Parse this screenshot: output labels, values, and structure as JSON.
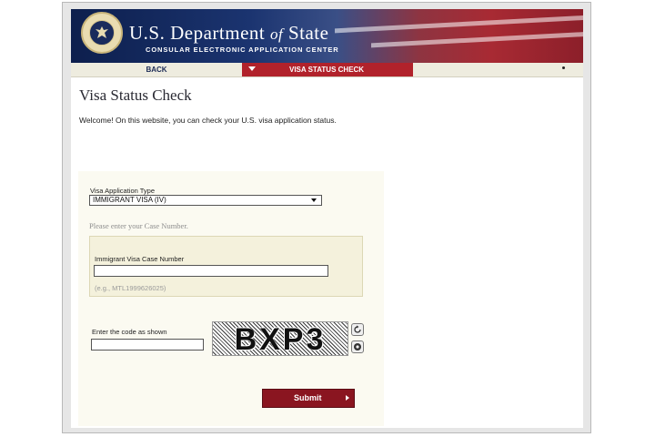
{
  "header": {
    "title_part1": "U.S. Department",
    "title_of": "of",
    "title_part2": "State",
    "subtitle": "CONSULAR ELECTRONIC APPLICATION CENTER",
    "seal_icon": "dept-state-seal-icon"
  },
  "nav": {
    "back_label": "BACK",
    "active_label": "VISA STATUS CHECK",
    "active_color": "#b1222b"
  },
  "page": {
    "title": "Visa Status Check",
    "welcome": "Welcome! On this website, you can check your U.S. visa application status."
  },
  "form": {
    "visa_type_label": "Visa Application Type",
    "visa_type_value": "IMMIGRANT VISA (IV)",
    "case_prompt": "Please enter your Case Number.",
    "case_label": "Immigrant Visa Case Number",
    "case_value": "",
    "case_example": "(e.g., MTL1999626025)",
    "code_label": "Enter the code as shown",
    "code_value": "",
    "captcha_text": "BXP3",
    "submit_label": "Submit",
    "submit_color": "#8a1520"
  }
}
